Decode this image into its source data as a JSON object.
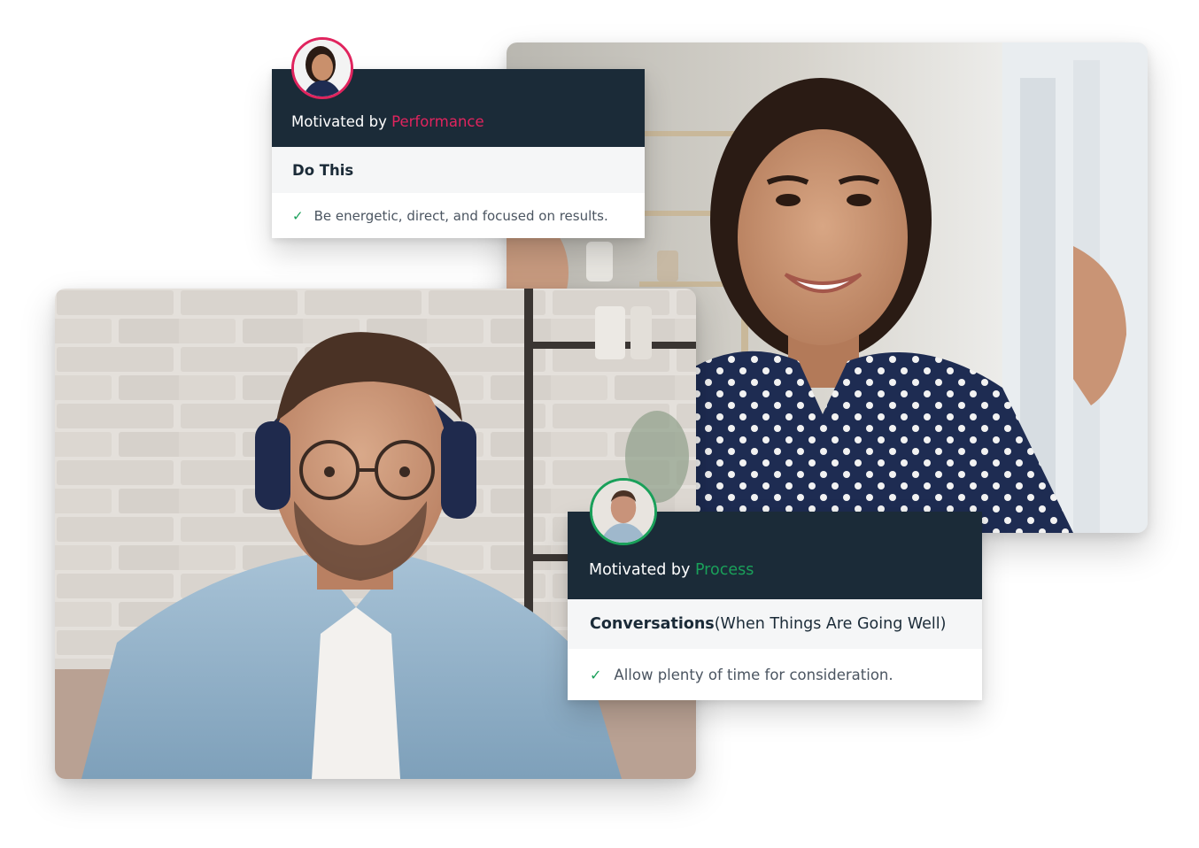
{
  "colors": {
    "card_header_bg": "#1b2b38",
    "performance_accent": "#e0245e",
    "process_accent": "#1aa05a",
    "check_color": "#1aa05a"
  },
  "cards": {
    "performance": {
      "motivated_prefix": "Motivated by ",
      "motivator": "Performance",
      "section_title": "Do This",
      "items": [
        {
          "icon": "check-icon",
          "text": "Be energetic, direct, and focused on results."
        }
      ]
    },
    "process": {
      "motivated_prefix": "Motivated by ",
      "motivator": "Process",
      "section_title": "Conversations",
      "section_qualifier": " (When Things Are Going Well)",
      "items": [
        {
          "icon": "check-icon",
          "text": "Allow plenty of time for consideration."
        }
      ]
    }
  },
  "icons": {
    "check": "✓"
  }
}
